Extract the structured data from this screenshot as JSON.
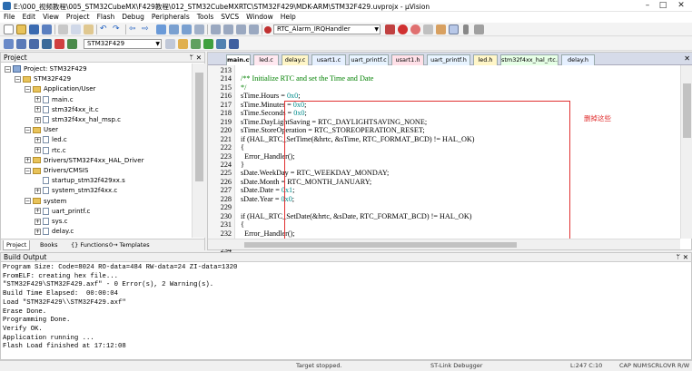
{
  "window": {
    "title": "E:\\000_视频教程\\005_STM32CubeMX\\F429教程\\012_STM32CubeMXRTC\\STM32F429\\MDK-ARM\\STM32F429.uvprojx - µVision"
  },
  "menu": [
    "File",
    "Edit",
    "View",
    "Project",
    "Flash",
    "Debug",
    "Peripherals",
    "Tools",
    "SVCS",
    "Window",
    "Help"
  ],
  "toolbar1": {
    "function_combo": "RTC_Alarm_IRQHandler"
  },
  "toolbar2": {
    "target_combo": "STM32F429"
  },
  "project_panel": {
    "title": "Project",
    "tree": [
      {
        "label": "Project: STM32F429",
        "level": 0,
        "kind": "project",
        "expander": "−"
      },
      {
        "label": "STM32F429",
        "level": 1,
        "kind": "folder",
        "expander": "−"
      },
      {
        "label": "Application/User",
        "level": 2,
        "kind": "folder",
        "expander": "−"
      },
      {
        "label": "main.c",
        "level": 3,
        "kind": "file",
        "expander": "+"
      },
      {
        "label": "stm32f4xx_it.c",
        "level": 3,
        "kind": "file",
        "expander": "+"
      },
      {
        "label": "stm32f4xx_hal_msp.c",
        "level": 3,
        "kind": "file",
        "expander": "+"
      },
      {
        "label": "User",
        "level": 2,
        "kind": "folder",
        "expander": "−"
      },
      {
        "label": "led.c",
        "level": 3,
        "kind": "file",
        "expander": "+"
      },
      {
        "label": "rtc.c",
        "level": 3,
        "kind": "file",
        "expander": "+"
      },
      {
        "label": "Drivers/STM32F4xx_HAL_Driver",
        "level": 2,
        "kind": "folder",
        "expander": "+"
      },
      {
        "label": "Drivers/CMSIS",
        "level": 2,
        "kind": "folder",
        "expander": "−"
      },
      {
        "label": "startup_stm32f429xx.s",
        "level": 3,
        "kind": "file",
        "expander": ""
      },
      {
        "label": "system_stm32f4xx.c",
        "level": 3,
        "kind": "file",
        "expander": "+"
      },
      {
        "label": "system",
        "level": 2,
        "kind": "folder",
        "expander": "−"
      },
      {
        "label": "uart_printf.c",
        "level": 3,
        "kind": "file",
        "expander": "+"
      },
      {
        "label": "sys.c",
        "level": 3,
        "kind": "file",
        "expander": "+"
      },
      {
        "label": "delay.c",
        "level": 3,
        "kind": "file",
        "expander": "+"
      }
    ],
    "tabs": [
      "Project",
      "Books",
      "{} Functions",
      "0→ Templates"
    ]
  },
  "editor": {
    "tabs": [
      {
        "label": "main.c*",
        "active": true,
        "color": "#ffffff"
      },
      {
        "label": "led.c",
        "active": false,
        "color": "#ffe8f0"
      },
      {
        "label": "delay.c",
        "active": false,
        "color": "#fff6c8"
      },
      {
        "label": "usart1.c",
        "active": false,
        "color": "#e6f0ff"
      },
      {
        "label": "uart_printf.c",
        "active": false,
        "color": "#e8f4ff"
      },
      {
        "label": "usart1.h",
        "active": false,
        "color": "#ffe0e8"
      },
      {
        "label": "uart_printf.h",
        "active": false,
        "color": "#e8f4ff"
      },
      {
        "label": "led.h",
        "active": false,
        "color": "#fff6c8"
      },
      {
        "label": "stm32f4xx_hal_rtc.h",
        "active": false,
        "color": "#e6ffe6"
      },
      {
        "label": "delay.h",
        "active": false,
        "color": "#e6f0ff"
      }
    ],
    "lines": [
      {
        "n": "213",
        "text": ""
      },
      {
        "n": "214",
        "text": "/** Initialize RTC and set the Time and Date"
      },
      {
        "n": "215",
        "text": "*/"
      },
      {
        "n": "216",
        "text": "sTime.Hours = 0x0;"
      },
      {
        "n": "217",
        "text": "sTime.Minutes = 0x0;"
      },
      {
        "n": "218",
        "text": "sTime.Seconds = 0x0;"
      },
      {
        "n": "219",
        "text": "sTime.DayLightSaving = RTC_DAYLIGHTSAVING_NONE;"
      },
      {
        "n": "220",
        "text": "sTime.StoreOperation = RTC_STOREOPERATION_RESET;"
      },
      {
        "n": "221",
        "text": "if (HAL_RTC_SetTime(&hrtc, &sTime, RTC_FORMAT_BCD) != HAL_OK)"
      },
      {
        "n": "222",
        "text": "{"
      },
      {
        "n": "223",
        "text": "  Error_Handler();"
      },
      {
        "n": "224",
        "text": "}"
      },
      {
        "n": "225",
        "text": "sDate.WeekDay = RTC_WEEKDAY_MONDAY;"
      },
      {
        "n": "226",
        "text": "sDate.Month = RTC_MONTH_JANUARY;"
      },
      {
        "n": "227",
        "text": "sDate.Date = 0x1;"
      },
      {
        "n": "228",
        "text": "sDate.Year = 0x0;"
      },
      {
        "n": "229",
        "text": ""
      },
      {
        "n": "230",
        "text": "if (HAL_RTC_SetDate(&hrtc, &sDate, RTC_FORMAT_BCD) != HAL_OK)"
      },
      {
        "n": "231",
        "text": "{"
      },
      {
        "n": "232",
        "text": "  Error_Handler();"
      },
      {
        "n": "233",
        "text": "}"
      },
      {
        "n": "234",
        "text": "/** Enable the Refout"
      }
    ],
    "annotation_note": "删掉这些"
  },
  "build_output": {
    "title": "Build Output",
    "lines": [
      "Program Size: Code=8024 RO-data=484 RW-data=24 ZI-data=1320",
      "FromELF: creating hex file...",
      "\"STM32F429\\STM32F429.axf\" - 0 Error(s), 2 Warning(s).",
      "Build Time Elapsed:  00:00:04",
      "Load \"STM32F429\\\\STM32F429.axf\"",
      "Erase Done.",
      "Programming Done.",
      "Verify OK.",
      "Application running ...",
      "Flash Load finished at 17:12:08"
    ]
  },
  "statusbar": {
    "target_state": "Target stopped.",
    "debugger": "ST-Link Debugger",
    "position": "L:247 C:10",
    "caps": "CAP",
    "num": "NUM",
    "scrl": "SCRL",
    "ovr": "OVR",
    "rw": "R/W"
  }
}
